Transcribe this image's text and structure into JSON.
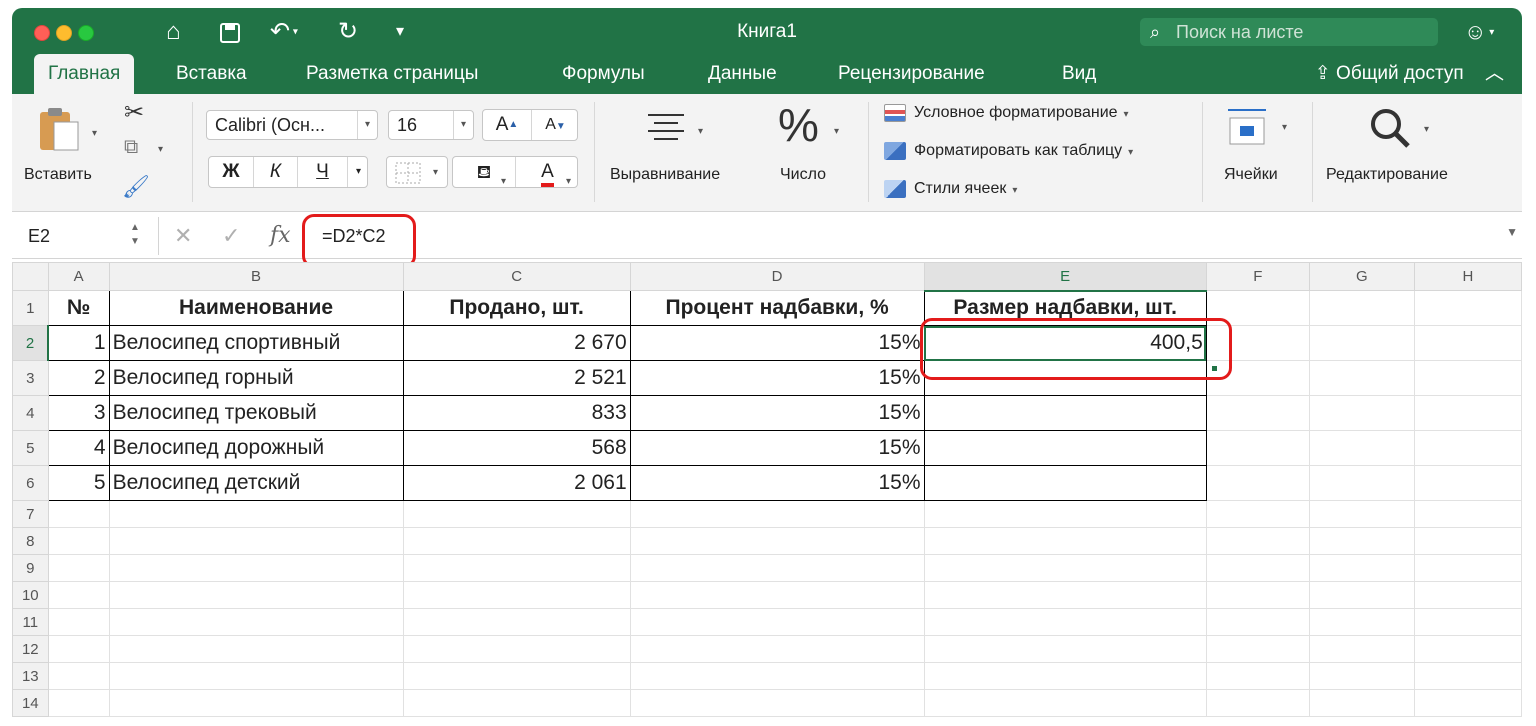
{
  "window": {
    "title": "Книга1",
    "search_placeholder": "Поиск на листе"
  },
  "tabs": [
    "Главная",
    "Вставка",
    "Разметка страницы",
    "Формулы",
    "Данные",
    "Рецензирование",
    "Вид"
  ],
  "share_label": "Общий доступ",
  "ribbon": {
    "paste_label": "Вставить",
    "font_name": "Calibri (Осн...",
    "font_size": "16",
    "increase_font": "A",
    "decrease_font": "A",
    "bold": "Ж",
    "italic": "К",
    "underline": "Ч",
    "font_color": "A",
    "alignment_label": "Выравнивание",
    "number_label": "Число",
    "percent_symbol": "%",
    "conditional_formatting": "Условное форматирование",
    "format_as_table": "Форматировать как таблицу",
    "cell_styles": "Стили ячеек",
    "cells_label": "Ячейки",
    "editing_label": "Редактирование"
  },
  "formula_bar": {
    "name_box": "E2",
    "formula": "=D2*C2",
    "fx": "fx"
  },
  "sheet": {
    "columns": [
      "A",
      "B",
      "C",
      "D",
      "E",
      "F",
      "G",
      "H"
    ],
    "header_row": [
      "№",
      "Наименование",
      "Продано, шт.",
      "Процент надбавки, %",
      "Размер надбавки, шт."
    ],
    "rows": [
      [
        "1",
        "Велосипед спортивный",
        "2 670",
        "15%",
        "400,5"
      ],
      [
        "2",
        "Велосипед горный",
        "2 521",
        "15%",
        ""
      ],
      [
        "3",
        "Велосипед трековый",
        "833",
        "15%",
        ""
      ],
      [
        "4",
        "Велосипед дорожный",
        "568",
        "15%",
        ""
      ],
      [
        "5",
        "Велосипед детский",
        "2 061",
        "15%",
        ""
      ]
    ],
    "row_numbers": [
      "1",
      "2",
      "3",
      "4",
      "5",
      "6",
      "7",
      "8",
      "9",
      "10",
      "11",
      "12",
      "13",
      "14"
    ]
  },
  "colors": {
    "excel_green": "#217346",
    "highlight_red": "#e31b1b"
  }
}
